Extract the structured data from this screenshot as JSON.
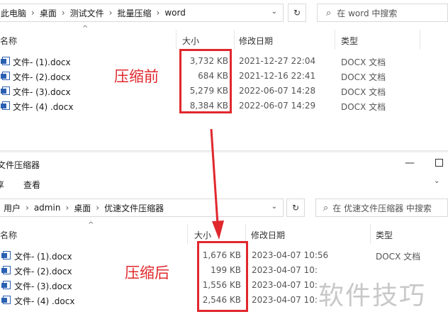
{
  "top_window": {
    "breadcrumb": [
      "此电脑",
      "桌面",
      "测试文件",
      "批量压缩",
      "word"
    ],
    "search_placeholder": "在 word 中搜索",
    "columns": {
      "name": "名称",
      "size": "大小",
      "date": "修改日期",
      "type": "类型"
    },
    "files": [
      {
        "name": "文件- (1).docx",
        "size": "3,732 KB",
        "date": "2021-12-27 22:04",
        "type": "DOCX 文档"
      },
      {
        "name": "文件- (2).docx",
        "size": "684 KB",
        "date": "2021-12-16 22:41",
        "type": "DOCX 文档"
      },
      {
        "name": "文件- (3).docx",
        "size": "5,279 KB",
        "date": "2022-06-07 14:28",
        "type": "DOCX 文档"
      },
      {
        "name": "文件- (4) .docx",
        "size": "8,384 KB",
        "date": "2022-06-07 14:29",
        "type": "DOCX 文档"
      }
    ],
    "annotation": "压缩前"
  },
  "bottom_window": {
    "title": "文件压缩器",
    "ribbon_tabs": [
      "享",
      "查看"
    ],
    "breadcrumb": [
      "用户",
      "admin",
      "桌面",
      "优速文件压缩器"
    ],
    "search_placeholder": "在 优速文件压缩器 中搜索",
    "columns": {
      "name": "名称",
      "size": "大小",
      "date": "修改日期",
      "type": "类型"
    },
    "files": [
      {
        "name": "文件- (1).docx",
        "size": "1,676 KB",
        "date": "2023-04-07 10:56",
        "type": "DOCX 文档"
      },
      {
        "name": "文件- (2).docx",
        "size": "199 KB",
        "date": "2023-04-07 10:",
        "type": ""
      },
      {
        "name": "文件- (3).docx",
        "size": "1,556 KB",
        "date": "2023-04-07 10:",
        "type": ""
      },
      {
        "name": "文件- (4) .docx",
        "size": "2,546 KB",
        "date": "2023-04-07 10:",
        "type": ""
      }
    ],
    "annotation": "压缩后"
  },
  "watermark": "软件技巧",
  "colors": {
    "annotation_red": "#e0282d",
    "word_blue": "#2b5fb0"
  }
}
